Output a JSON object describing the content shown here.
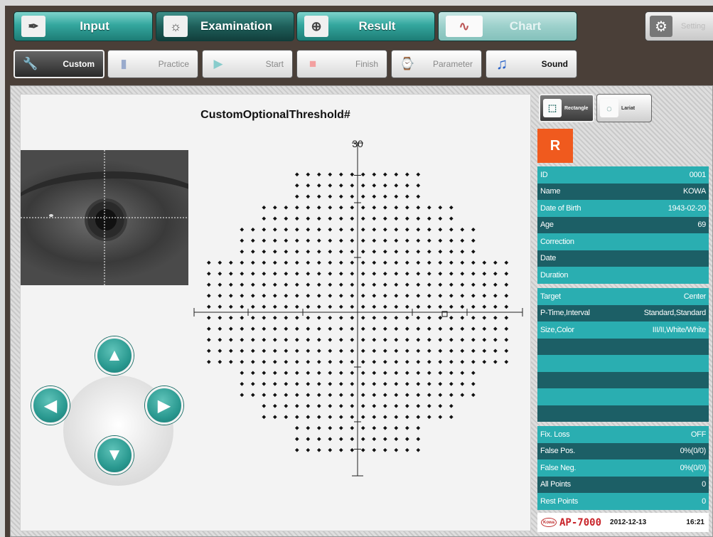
{
  "main_nav": [
    {
      "label": "Input",
      "icon": "pen-icon",
      "state": "normal"
    },
    {
      "label": "Examination",
      "icon": "examination-icon",
      "state": "active"
    },
    {
      "label": "Result",
      "icon": "result-icon",
      "state": "normal"
    },
    {
      "label": "Chart",
      "icon": "chart-icon",
      "state": "disabled"
    }
  ],
  "setting": {
    "label": "Setting",
    "icon": "gear-icon"
  },
  "sub_nav": [
    {
      "label": "Custom",
      "icon": "wrench-icon",
      "state": "active"
    },
    {
      "label": "Practice",
      "icon": "book-icon",
      "state": "disabled"
    },
    {
      "label": "Start",
      "icon": "play-icon",
      "state": "disabled"
    },
    {
      "label": "Finish",
      "icon": "stop-icon",
      "state": "disabled"
    },
    {
      "label": "Parameter",
      "icon": "parameter-icon",
      "state": "disabled"
    },
    {
      "label": "Sound",
      "icon": "music-note-icon",
      "state": "normal"
    }
  ],
  "plot": {
    "title": "CustomOptionalThreshold#",
    "scale_label": "30"
  },
  "select_tools": [
    {
      "label": "Rectangle",
      "icon": "rectangle-select-icon",
      "state": "active"
    },
    {
      "label": "Lariat",
      "icon": "lasso-icon",
      "state": "normal"
    }
  ],
  "eye_side": "R",
  "patient": [
    {
      "label": "ID",
      "value": "0001"
    },
    {
      "label": "Name",
      "value": "KOWA"
    },
    {
      "label": "Date of Birth",
      "value": "1943-02-20"
    },
    {
      "label": "Age",
      "value": "69"
    },
    {
      "label": "Correction",
      "value": ""
    },
    {
      "label": "Date",
      "value": ""
    },
    {
      "label": "Duration",
      "value": ""
    }
  ],
  "exam": [
    {
      "label": "Target",
      "value": "Center"
    },
    {
      "label": "P-Time,Interval",
      "value": "Standard,Standard"
    },
    {
      "label": "Size,Color",
      "value": "III/II,White/White"
    },
    {
      "label": "",
      "value": ""
    },
    {
      "label": "",
      "value": ""
    },
    {
      "label": "",
      "value": ""
    },
    {
      "label": "",
      "value": ""
    },
    {
      "label": "",
      "value": ""
    }
  ],
  "reliability": [
    {
      "label": "Fix. Loss",
      "value": "OFF"
    },
    {
      "label": "False Pos.",
      "value": "0%(0/0)"
    },
    {
      "label": "False Neg.",
      "value": "0%(0/0)"
    },
    {
      "label": "All Points",
      "value": "0"
    },
    {
      "label": "Rest Points",
      "value": "0"
    }
  ],
  "footer": {
    "brand": "Kowa",
    "model": "AP-7000",
    "date": "2012-12-13",
    "time": "16:21"
  },
  "colors": {
    "teal": "#2aaeb1",
    "dark_teal": "#1c5f66",
    "accent_orange": "#f05a1e"
  }
}
